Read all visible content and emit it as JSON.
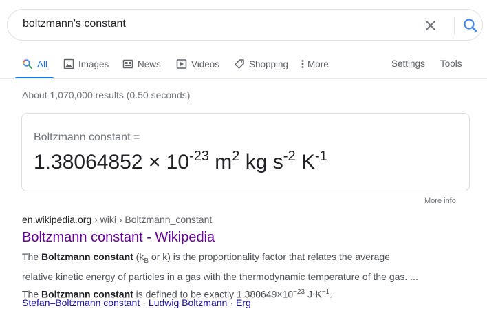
{
  "search": {
    "query": "boltzmann's constant"
  },
  "tabs": [
    {
      "label": "All",
      "icon": "search-icon"
    },
    {
      "label": "Images",
      "icon": "image-icon"
    },
    {
      "label": "News",
      "icon": "news-icon"
    },
    {
      "label": "Videos",
      "icon": "video-icon"
    },
    {
      "label": "Shopping",
      "icon": "tag-icon"
    },
    {
      "label": "More",
      "icon": "more-dots-icon"
    }
  ],
  "tools": {
    "settings": "Settings",
    "tools": "Tools"
  },
  "result_stats": "About 1,070,000 results (0.50 seconds)",
  "answer_card": {
    "label": "Boltzmann constant =",
    "mantissa": "1.38064852 × 10",
    "exp_10": "-23",
    "unit_m": " m",
    "exp_m": "2",
    "unit_kg_s": " kg s",
    "exp_s": "-2",
    "unit_K": " K",
    "exp_K": "-1",
    "more_info": "More info"
  },
  "result": {
    "site": "en.wikipedia.org",
    "path": " › wiki › Boltzmann_constant",
    "title": "Boltzmann constant - Wikipedia",
    "snippet": {
      "l1_a": "The ",
      "l1_b": "Boltzmann constant",
      "l1_c": " (k",
      "l1_sub": "B",
      "l1_d": " or k) is the proportionality factor that relates the average",
      "l2": "relative kinetic energy of particles in a gas with the thermodynamic temperature of the gas. ...",
      "l3_a": "The ",
      "l3_b": "Boltzmann constant",
      "l3_c": " is defined to be exactly 1.380649×10",
      "l3_sup": "−23",
      "l3_d": " J⋅K",
      "l3_sup2": "−1",
      "l3_e": "."
    },
    "sitelinks": [
      "Stefan–Boltzmann constant",
      "Ludwig Boltzmann",
      "Erg"
    ]
  },
  "colors": {
    "accent": "#1a73e8",
    "visited_link": "#660099",
    "link": "#1a0dab"
  }
}
